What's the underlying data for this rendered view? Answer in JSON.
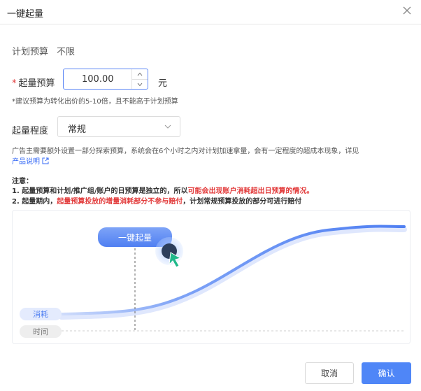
{
  "dialog": {
    "title": "一键起量"
  },
  "plan": {
    "label": "计划预算",
    "value": "不限"
  },
  "budget": {
    "label": "起量预算",
    "value": "100.00",
    "unit": "元",
    "hint": "*建议预算为转化出价的5-10倍，且不能高于计划预算"
  },
  "level": {
    "label": "起量程度",
    "value": "常规"
  },
  "description": {
    "text": "广告主需要额外设置一部分探索预算，系统会在6个小时之内对计划加速拿量，会有一定程度的超成本现象，详见",
    "link": "产品说明"
  },
  "notes": {
    "title": "注意：",
    "n1_a": "1. 起量预算和计划/推广组/账户的日预算是独立的，所以",
    "n1_b": "可能会出现账户消耗超出日预算的情况。",
    "n2_a": "2. 起量期内，",
    "n2_b": "起量预算投放的增量消耗部分不参与赔付",
    "n2_c": "，计划常规预算投放的部分可进行赔付"
  },
  "illustration": {
    "boost_label": "一键起量",
    "y_label": "消耗",
    "x_label": "时间",
    "colors": {
      "curve": "#5b86f5",
      "pill": "#4f7ff2"
    }
  },
  "buttons": {
    "cancel": "取消",
    "confirm": "确认"
  }
}
